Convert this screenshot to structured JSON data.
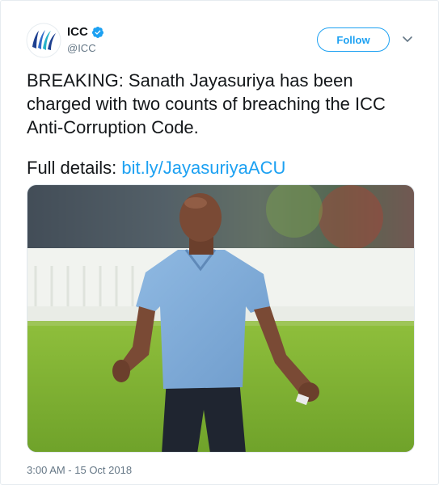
{
  "account": {
    "name": "ICC",
    "handle": "@ICC",
    "verified": true,
    "avatar_icon": "icc-logo-icon"
  },
  "actions": {
    "follow_label": "Follow",
    "more_icon": "chevron-down-icon"
  },
  "tweet": {
    "lines": [
      "BREAKING: Sanath Jayasuriya has been",
      "charged with two counts of breaching the ICC",
      "Anti-Corruption Code."
    ],
    "details_prefix": "Full details:",
    "details_link": "bit.ly/JayasuriyaACU",
    "timestamp": "3:00 AM - 15 Oct 2018"
  },
  "colors": {
    "accent": "#1da1f2",
    "text": "#14171a",
    "secondary": "#657786"
  }
}
